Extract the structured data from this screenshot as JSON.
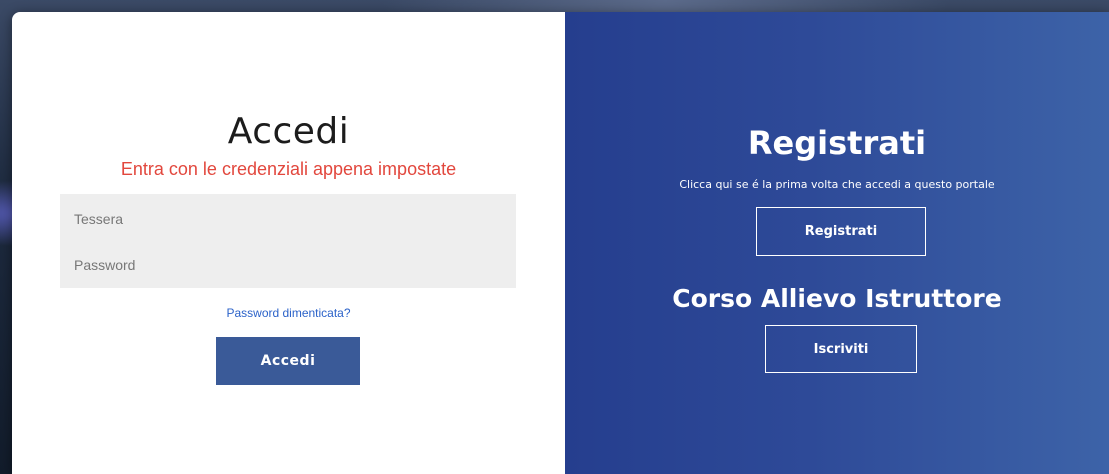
{
  "login": {
    "title": "Accedi",
    "subtitle": "Entra con le credenziali appena impostate",
    "tessera_placeholder": "Tessera",
    "tessera_value": "",
    "password_placeholder": "Password",
    "password_value": "",
    "forgot_label": "Password dimenticata?",
    "submit_label": "Accedi"
  },
  "register": {
    "title": "Registrati",
    "subtitle": "Clicca qui se é la prima volta che accedi a questo portale",
    "button_label": "Registrati"
  },
  "course": {
    "title": "Corso Allievo Istruttore",
    "button_label": "Iscriviti"
  },
  "colors": {
    "accent_red": "#e2473d",
    "button_blue": "#3a5a98",
    "link_blue": "#2b62c9",
    "panel_blue_start": "#253e8e",
    "panel_blue_end": "#3d63a8"
  }
}
